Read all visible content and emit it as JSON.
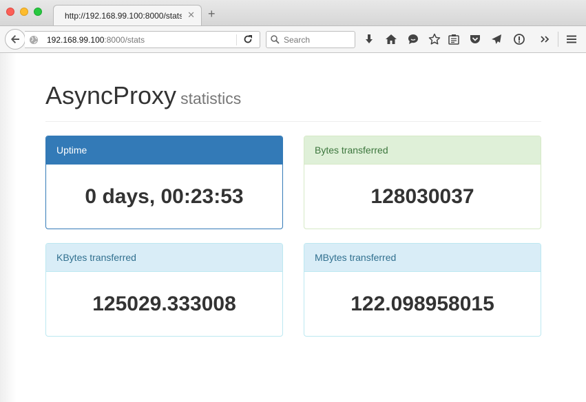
{
  "browser": {
    "tab_title": "http://192.168.99.100:8000/stats",
    "tab_close_glyph": "✕",
    "new_tab_glyph": "+",
    "url_host": "192.168.99.100",
    "url_rest": ":8000/stats",
    "search_placeholder": "Search",
    "toolbar_icons": [
      "download-icon",
      "home-icon",
      "chat-icon",
      "bookmark-star-icon",
      "reading-list-icon",
      "pocket-icon",
      "send-icon",
      "info-icon",
      "overflow-icon",
      "menu-icon"
    ]
  },
  "page": {
    "title": "AsyncProxy",
    "subtitle": "statistics"
  },
  "panels": [
    {
      "heading": "Uptime",
      "value": "0 days, 00:23:53",
      "style": "primary"
    },
    {
      "heading": "Bytes transferred",
      "value": "128030037",
      "style": "success"
    },
    {
      "heading": "KBytes transferred",
      "value": "125029.333008",
      "style": "info"
    },
    {
      "heading": "MBytes transferred",
      "value": "122.098958015",
      "style": "info"
    }
  ],
  "colors": {
    "primary": "#337ab7",
    "success_bg": "#dff0d8",
    "success_text": "#3c763d",
    "info_bg": "#d9edf7",
    "info_text": "#31708f"
  }
}
